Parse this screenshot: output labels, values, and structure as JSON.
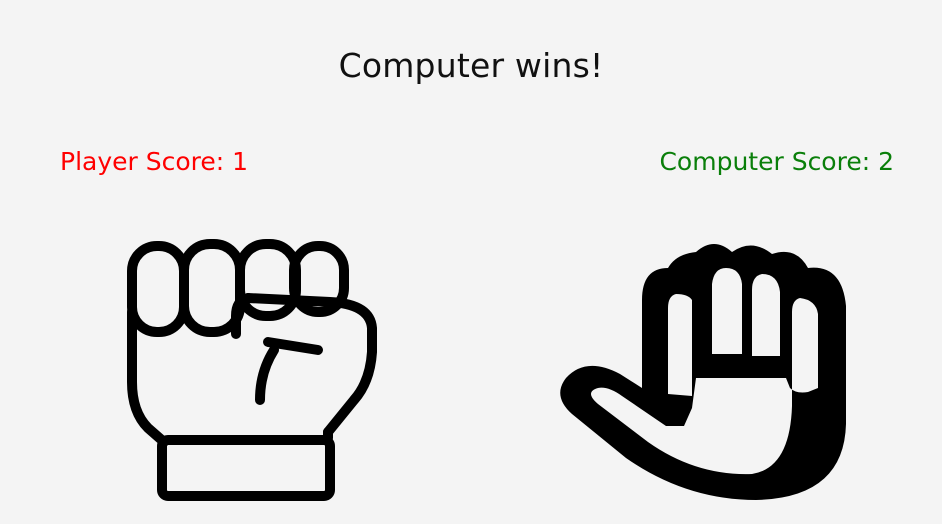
{
  "result": {
    "text": "Computer wins!"
  },
  "scores": {
    "player_label": "Player Score: 1",
    "computer_label": "Computer Score: 2",
    "player_color": "#ff0000",
    "computer_color": "#0a7f0a"
  },
  "choices": {
    "player": {
      "icon": "rock-fist-icon"
    },
    "computer": {
      "icon": "paper-hand-icon"
    }
  }
}
